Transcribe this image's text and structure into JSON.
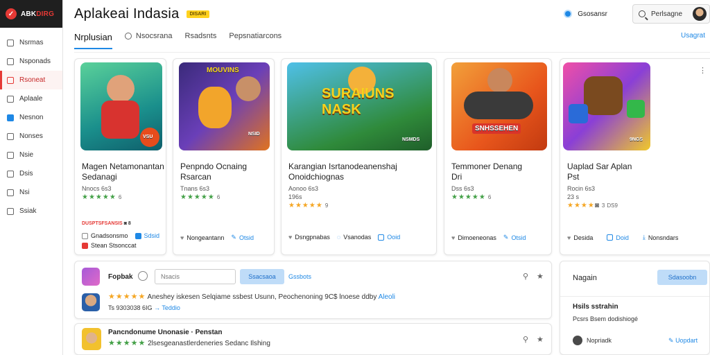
{
  "brand": {
    "name_a": "ABK",
    "name_b": "DIRG"
  },
  "sidebar": {
    "items": [
      {
        "label": "Nsrmas"
      },
      {
        "label": "Nsponads"
      },
      {
        "label": "Rsoneat"
      },
      {
        "label": "Aplaale"
      },
      {
        "label": "Nesnon"
      },
      {
        "label": "Nonses"
      },
      {
        "label": "Nsie"
      },
      {
        "label": "Dsis"
      },
      {
        "label": "Nsi"
      },
      {
        "label": "Ssiak"
      }
    ]
  },
  "header": {
    "title": "Aplakeai Indasia",
    "tag": "DISARI",
    "link": "Gsosansr",
    "search_text": "Perlsagne"
  },
  "tabs": [
    {
      "label": "Nrplusian"
    },
    {
      "label": "Nsocsrana"
    },
    {
      "label": "Rsadsnts"
    },
    {
      "label": "Pepsnatiarcons"
    }
  ],
  "tabs_right": "Usagrat",
  "cards": [
    {
      "title": "Magen Netamonantan",
      "title2": "Sedanagi",
      "sub": "Nnocs 6s3",
      "rating": "6",
      "extra1": "DUSPTSFSANSIS",
      "extra2": "8",
      "act1": "Gnadsonsmo",
      "act2": "Sdsid",
      "act3": "Stean Stsonccat",
      "badge": "VSU"
    },
    {
      "title": "Penpndo Ocnaing",
      "title2": "Rsarcan",
      "sub": "Tnans 6s3",
      "rating": "6",
      "act1": "Nongeantann",
      "act2": "Otsid",
      "badge": "NSID"
    },
    {
      "title": "Karangian Isrtanodeanenshaj",
      "title2": "Onoidchiognas",
      "sub": "Aonoo 6s3",
      "sub2": "196s",
      "rating": "9",
      "act1": "Dsngpnabas",
      "act2": "Vsanodas",
      "act3": "Ooid",
      "art": "SURAIUNS NASK",
      "badge": "NSMDS"
    },
    {
      "title": "Temmoner Denang",
      "title2": "Dri",
      "sub": "Dss 6s3",
      "rating": "6",
      "act1": "Dimoeneonas",
      "act2": "Otsid",
      "badge": "SNHSSEHEN"
    },
    {
      "title": "Uaplad Sar Aplan",
      "title2": "Pst",
      "sub": "Rocin 6s3",
      "sub2": "23 s",
      "rating": "3",
      "extra": "DS9",
      "act1": "Desida",
      "act2": "Doid",
      "act3": "Nonsndars",
      "badge": "9NGS"
    }
  ],
  "list": {
    "name": "Fopbak",
    "input_placeholder": "Nsacis",
    "btn": "Ssacsaoa",
    "link": "Gssbots",
    "row1": "Aneshey iskesen Selqiame ssbest Usunn, Peochenoning 9C$ lnoese ddby",
    "row1_link": "Aleoli",
    "row1_sub": "Ts 9303038 6IG",
    "row1_sub_link": "→ Teddio",
    "row2_title": "Pancndonume Unonasie · Penstan",
    "row2_sub": "2lsesgeanastlerdeneries Sedanc Ilshing"
  },
  "side_panel": {
    "title": "Nagain",
    "btn": "Sdasoobn",
    "sub_title": "Hsils sstrahin",
    "sub_text": "Pcsrs Bsem dodishiogé",
    "user": "Nopriadk",
    "link": "Uopdart"
  },
  "colors": {
    "accent": "#1e88e5",
    "brand_red": "#e53935",
    "star": "#f5a623",
    "star_green": "#43a047"
  }
}
